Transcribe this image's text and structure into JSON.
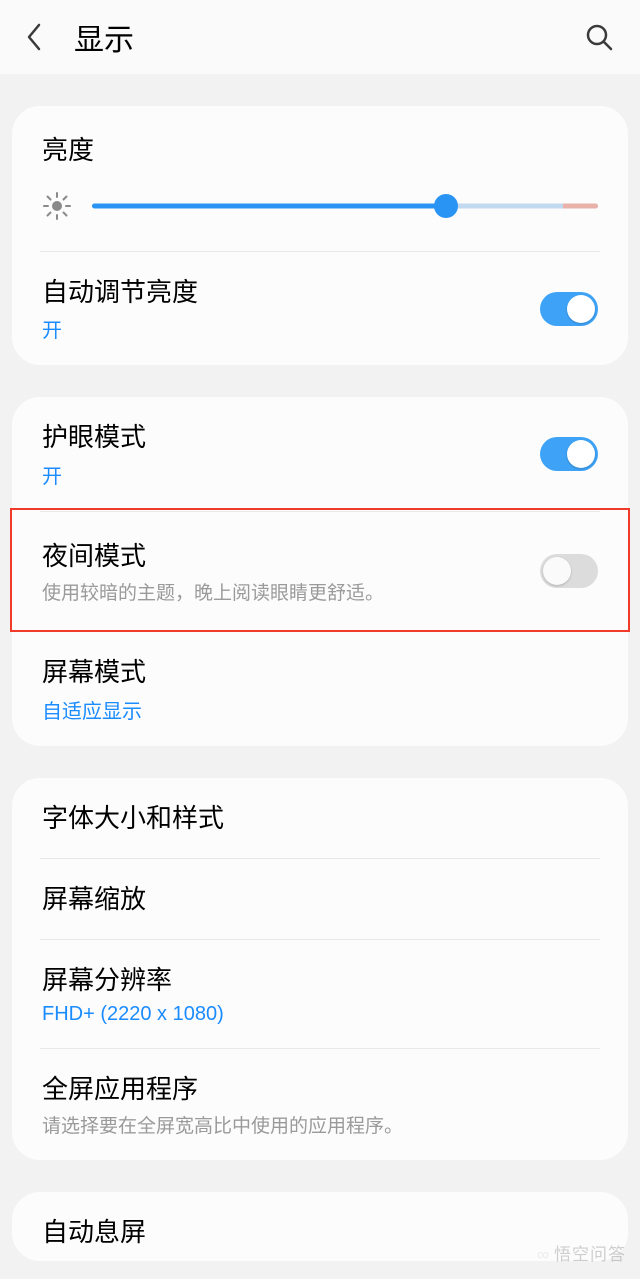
{
  "header": {
    "title": "显示"
  },
  "card1": {
    "brightness_label": "亮度",
    "slider_percent": 70,
    "auto_brightness": {
      "title": "自动调节亮度",
      "status": "开",
      "on": true
    }
  },
  "card2": {
    "eye_comfort": {
      "title": "护眼模式",
      "status": "开",
      "on": true
    },
    "night_mode": {
      "title": "夜间模式",
      "desc": "使用较暗的主题，晚上阅读眼睛更舒适。",
      "on": false
    },
    "screen_mode": {
      "title": "屏幕模式",
      "value": "自适应显示"
    }
  },
  "card3": {
    "font": {
      "title": "字体大小和样式"
    },
    "zoom": {
      "title": "屏幕缩放"
    },
    "resolution": {
      "title": "屏幕分辨率",
      "value": "FHD+ (2220 x 1080)"
    },
    "fullscreen": {
      "title": "全屏应用程序",
      "desc": "请选择要在全屏宽高比中使用的应用程序。"
    }
  },
  "card4": {
    "auto_off": {
      "title": "自动息屏"
    }
  },
  "watermark": "悟空问答"
}
